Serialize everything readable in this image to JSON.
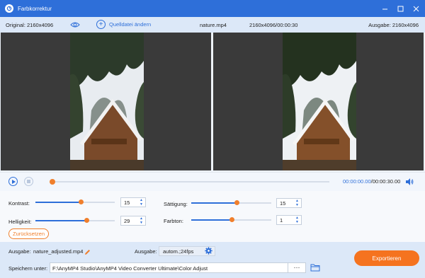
{
  "window": {
    "title": "Farbkorrektur",
    "logo_icon": "app-logo-icon",
    "controls": [
      "minimize-icon",
      "maximize-icon",
      "close-icon"
    ]
  },
  "infobar": {
    "original_label": "Original: 2160x4096",
    "source_button_label": "Quelldatei ändern",
    "filename": "nature.mp4",
    "meta": "2160x4096/00:00:30",
    "output_label": "Ausgabe: 2160x4096"
  },
  "player": {
    "current_time": "00:00:00.00",
    "total_time": "/00:00:30.00",
    "progress": 0
  },
  "adjustments": {
    "kontrast": {
      "label": "Kontrast:",
      "value": "15",
      "level": 0.57
    },
    "helligkeit": {
      "label": "Helligkeit:",
      "value": "29",
      "level": 0.64
    },
    "saettigung": {
      "label": "Sättigung:",
      "value": "15",
      "level": 0.57
    },
    "farbton": {
      "label": "Farbton:",
      "value": "1",
      "level": 0.5
    },
    "reset_label": "Zurücksetzen"
  },
  "output": {
    "name_label": "Ausgabe:",
    "name_value": "nature_adjusted.mp4",
    "format_label": "Ausgabe:",
    "format_value": "autom.;24fps",
    "save_label": "Speichern unter:",
    "save_path": "F:\\AnyMP4 Studio\\AnyMP4 Video Converter Ultimate\\Color Adjust",
    "browse_label": "···",
    "export_label": "Exportieren"
  },
  "colors": {
    "accent": "#2e6fd9",
    "orange": "#f07f2c",
    "export": "#f5731f"
  }
}
